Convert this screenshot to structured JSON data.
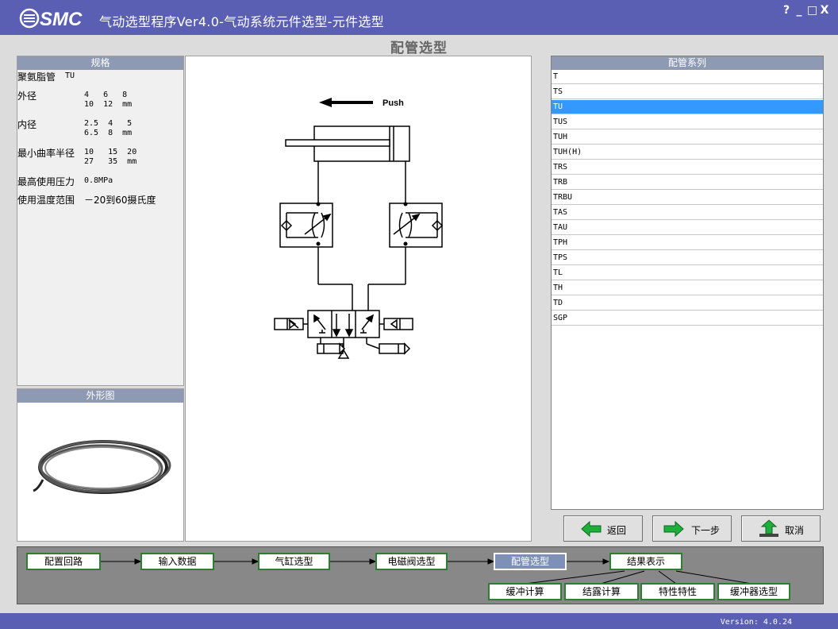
{
  "window": {
    "title": "气动选型程序Ver4.0-气动系统元件选型-元件选型",
    "controls": [
      "?",
      "_",
      "□",
      "X"
    ],
    "logo_text": "SMC"
  },
  "section_title": "配管选型",
  "spec": {
    "header": "规格",
    "rows": [
      {
        "label": "聚氨脂管",
        "value": "TU"
      },
      {
        "label": "外径",
        "value": "4   6   8\n10  12  mm"
      },
      {
        "label": "内径",
        "value": "2.5  4   5\n6.5  8  mm"
      },
      {
        "label": "最小曲率半径",
        "value": "10   15  20\n27   35  mm"
      },
      {
        "label": "最高使用压力",
        "value": "0.8MPa"
      },
      {
        "label": "使用温度范围",
        "value": "－20到60摄氏度"
      }
    ]
  },
  "shape": {
    "header": "外形图"
  },
  "diagram": {
    "push_label": "Push"
  },
  "series": {
    "header": "配管系列",
    "selected": "TU",
    "items": [
      "T",
      "TS",
      "TU",
      "TUS",
      "TUH",
      "TUH(H)",
      "TRS",
      "TRB",
      "TRBU",
      "TAS",
      "TAU",
      "TPH",
      "TPS",
      "TL",
      "TH",
      "TD",
      "SGP"
    ]
  },
  "buttons": {
    "back": "返回",
    "next": "下一步",
    "cancel": "取消"
  },
  "flow": {
    "steps": [
      "配置回路",
      "输入数据",
      "气缸选型",
      "电磁阀选型",
      "配管选型",
      "结果表示"
    ],
    "active": "配管选型",
    "substeps": [
      "缓冲计算",
      "结露计算",
      "特性特性",
      "缓冲器选型"
    ]
  },
  "version": "Version: 4.0.24",
  "colors": {
    "titlebar": "#5a5fb4",
    "selection": "#3399ff",
    "step_border": "#2e7d32",
    "panel_header": "#8e9ab4"
  }
}
